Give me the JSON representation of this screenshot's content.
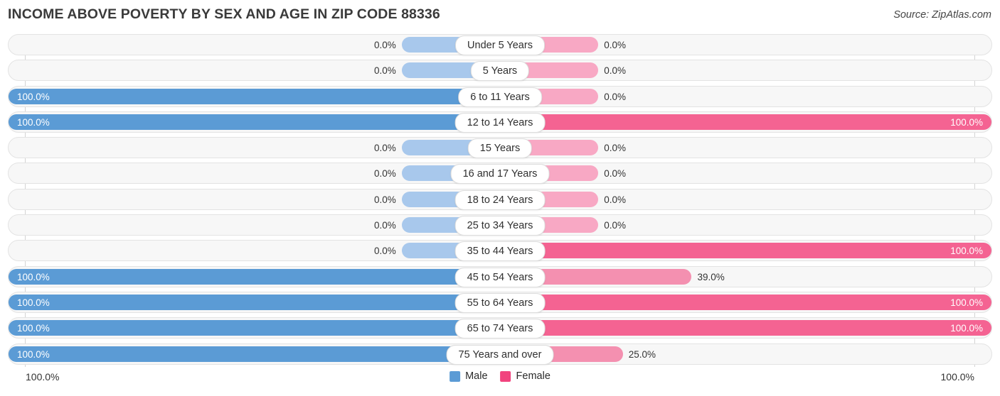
{
  "header": {
    "title": "INCOME ABOVE POVERTY BY SEX AND AGE IN ZIP CODE 88336",
    "source": "Source: ZipAtlas.com"
  },
  "footer": {
    "axis_left": "100.0%",
    "axis_right": "100.0%"
  },
  "legend": {
    "male_label": "Male",
    "female_label": "Female"
  },
  "colors": {
    "male": "#5b9bd5",
    "male_zero": "#a8c8ec",
    "female": "#f1437e",
    "female_full": "#f46392",
    "female_mid": "#f490b0",
    "female_zero": "#f8a8c4",
    "track": "#f7f7f7",
    "track_border": "#e3e3e3"
  },
  "chart_data": {
    "type": "bar",
    "title": "INCOME ABOVE POVERTY BY SEX AND AGE IN ZIP CODE 88336",
    "subtitle": "Source: ZipAtlas.com",
    "orientation": "horizontal-diverging",
    "xlabel": "",
    "ylabel": "",
    "xlim": [
      0,
      100
    ],
    "axis_left_max": "100.0%",
    "axis_right_max": "100.0%",
    "grid": false,
    "legend_position": "bottom-center",
    "categories": [
      "Under 5 Years",
      "5 Years",
      "6 to 11 Years",
      "12 to 14 Years",
      "15 Years",
      "16 and 17 Years",
      "18 to 24 Years",
      "25 to 34 Years",
      "35 to 44 Years",
      "45 to 54 Years",
      "55 to 64 Years",
      "65 to 74 Years",
      "75 Years and over"
    ],
    "series": [
      {
        "name": "Male",
        "values": [
          0.0,
          0.0,
          100.0,
          100.0,
          0.0,
          0.0,
          0.0,
          0.0,
          0.0,
          100.0,
          100.0,
          100.0,
          100.0
        ],
        "labels": [
          "0.0%",
          "0.0%",
          "100.0%",
          "100.0%",
          "0.0%",
          "0.0%",
          "0.0%",
          "0.0%",
          "0.0%",
          "100.0%",
          "100.0%",
          "100.0%",
          "100.0%"
        ]
      },
      {
        "name": "Female",
        "values": [
          0.0,
          0.0,
          0.0,
          100.0,
          0.0,
          0.0,
          0.0,
          0.0,
          100.0,
          39.0,
          100.0,
          100.0,
          25.0
        ],
        "labels": [
          "0.0%",
          "0.0%",
          "0.0%",
          "100.0%",
          "0.0%",
          "0.0%",
          "0.0%",
          "0.0%",
          "100.0%",
          "39.0%",
          "100.0%",
          "100.0%",
          "25.0%"
        ]
      }
    ]
  },
  "rows": [
    {
      "label": "Under 5 Years",
      "male": {
        "value": 0.0,
        "text": "0.0%",
        "zero": true,
        "inside": false
      },
      "female": {
        "value": 0.0,
        "text": "0.0%",
        "zero": true,
        "inside": false
      }
    },
    {
      "label": "5 Years",
      "male": {
        "value": 0.0,
        "text": "0.0%",
        "zero": true,
        "inside": false
      },
      "female": {
        "value": 0.0,
        "text": "0.0%",
        "zero": true,
        "inside": false
      }
    },
    {
      "label": "6 to 11 Years",
      "male": {
        "value": 100.0,
        "text": "100.0%",
        "zero": false,
        "inside": true
      },
      "female": {
        "value": 0.0,
        "text": "0.0%",
        "zero": true,
        "inside": false
      }
    },
    {
      "label": "12 to 14 Years",
      "male": {
        "value": 100.0,
        "text": "100.0%",
        "zero": false,
        "inside": true
      },
      "female": {
        "value": 100.0,
        "text": "100.0%",
        "zero": false,
        "inside": true
      }
    },
    {
      "label": "15 Years",
      "male": {
        "value": 0.0,
        "text": "0.0%",
        "zero": true,
        "inside": false
      },
      "female": {
        "value": 0.0,
        "text": "0.0%",
        "zero": true,
        "inside": false
      }
    },
    {
      "label": "16 and 17 Years",
      "male": {
        "value": 0.0,
        "text": "0.0%",
        "zero": true,
        "inside": false
      },
      "female": {
        "value": 0.0,
        "text": "0.0%",
        "zero": true,
        "inside": false
      }
    },
    {
      "label": "18 to 24 Years",
      "male": {
        "value": 0.0,
        "text": "0.0%",
        "zero": true,
        "inside": false
      },
      "female": {
        "value": 0.0,
        "text": "0.0%",
        "zero": true,
        "inside": false
      }
    },
    {
      "label": "25 to 34 Years",
      "male": {
        "value": 0.0,
        "text": "0.0%",
        "zero": true,
        "inside": false
      },
      "female": {
        "value": 0.0,
        "text": "0.0%",
        "zero": true,
        "inside": false
      }
    },
    {
      "label": "35 to 44 Years",
      "male": {
        "value": 0.0,
        "text": "0.0%",
        "zero": true,
        "inside": false
      },
      "female": {
        "value": 100.0,
        "text": "100.0%",
        "zero": false,
        "inside": true
      }
    },
    {
      "label": "45 to 54 Years",
      "male": {
        "value": 100.0,
        "text": "100.0%",
        "zero": false,
        "inside": true
      },
      "female": {
        "value": 39.0,
        "text": "39.0%",
        "zero": false,
        "inside": false
      }
    },
    {
      "label": "55 to 64 Years",
      "male": {
        "value": 100.0,
        "text": "100.0%",
        "zero": false,
        "inside": true
      },
      "female": {
        "value": 100.0,
        "text": "100.0%",
        "zero": false,
        "inside": true
      }
    },
    {
      "label": "65 to 74 Years",
      "male": {
        "value": 100.0,
        "text": "100.0%",
        "zero": false,
        "inside": true
      },
      "female": {
        "value": 100.0,
        "text": "100.0%",
        "zero": false,
        "inside": true
      }
    },
    {
      "label": "75 Years and over",
      "male": {
        "value": 100.0,
        "text": "100.0%",
        "zero": false,
        "inside": true
      },
      "female": {
        "value": 25.0,
        "text": "25.0%",
        "zero": false,
        "inside": false
      }
    }
  ]
}
